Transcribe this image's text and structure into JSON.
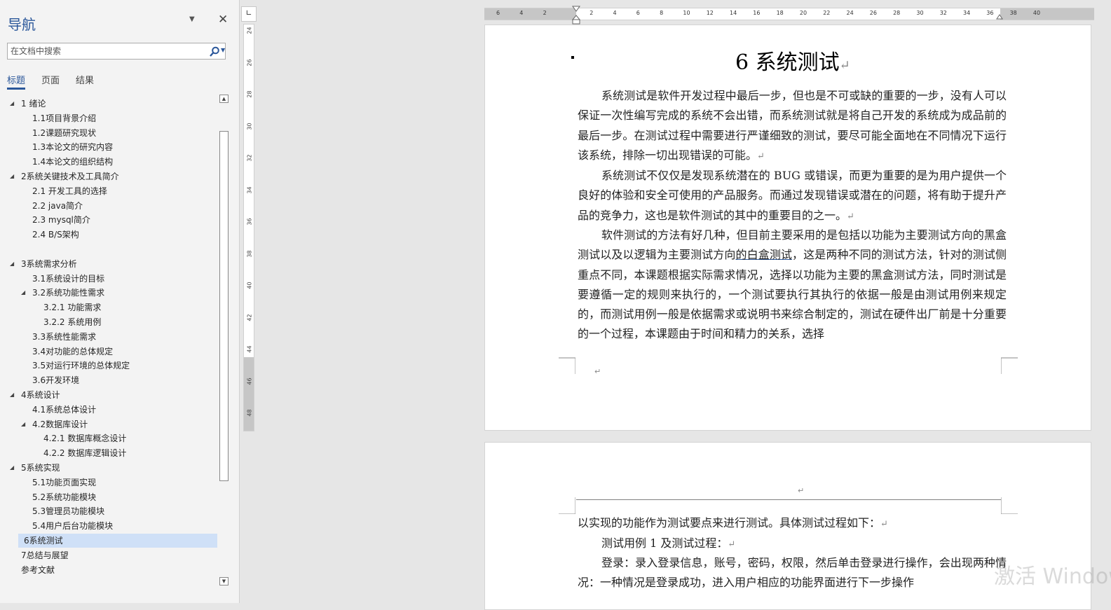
{
  "nav": {
    "title": "导航",
    "search_placeholder": "在文档中搜索",
    "tabs": [
      "标题",
      "页面",
      "结果"
    ],
    "tree": [
      {
        "label": "1 绪论",
        "level": 1,
        "expanded": true
      },
      {
        "label": "1.1项目背景介绍",
        "level": 2
      },
      {
        "label": "1.2课题研究现状",
        "level": 2
      },
      {
        "label": "1.3本论文的研究内容",
        "level": 2
      },
      {
        "label": "1.4本论文的组织结构",
        "level": 2
      },
      {
        "label": "2系统关键技术及工具简介",
        "level": 1,
        "expanded": true
      },
      {
        "label": "2.1 开发工具的选择",
        "level": 2
      },
      {
        "label": "2.2 java简介",
        "level": 2
      },
      {
        "label": "2.3 mysql简介",
        "level": 2
      },
      {
        "label": "2.4 B/S架构",
        "level": 2
      },
      {
        "label": "",
        "level": 2
      },
      {
        "label": "3系统需求分析",
        "level": 1,
        "expanded": true
      },
      {
        "label": "3.1系统设计的目标",
        "level": 2
      },
      {
        "label": "3.2系统功能性需求",
        "level": 2,
        "expanded": true
      },
      {
        "label": "3.2.1 功能需求",
        "level": 3
      },
      {
        "label": "3.2.2 系统用例",
        "level": 3
      },
      {
        "label": "3.3系统性能需求",
        "level": 2
      },
      {
        "label": "3.4对功能的总体规定",
        "level": 2
      },
      {
        "label": "3.5对运行环境的总体规定",
        "level": 2
      },
      {
        "label": "3.6开发环境",
        "level": 2
      },
      {
        "label": "4系统设计",
        "level": 1,
        "expanded": true
      },
      {
        "label": "4.1系统总体设计",
        "level": 2
      },
      {
        "label": "4.2数据库设计",
        "level": 2,
        "expanded": true
      },
      {
        "label": "4.2.1 数据库概念设计",
        "level": 3
      },
      {
        "label": "4.2.2 数据库逻辑设计",
        "level": 3
      },
      {
        "label": "5系统实现",
        "level": 1,
        "expanded": true
      },
      {
        "label": "5.1功能页面实现",
        "level": 2
      },
      {
        "label": "5.2系统功能模块",
        "level": 2
      },
      {
        "label": "5.3管理员功能模块",
        "level": 2
      },
      {
        "label": "5.4用户后台功能模块",
        "level": 2
      },
      {
        "label": "6系统测试",
        "level": 1,
        "selected": true
      },
      {
        "label": "7总结与展望",
        "level": 1
      },
      {
        "label": "参考文献",
        "level": 1
      }
    ]
  },
  "vruler": {
    "numbers": [
      "24",
      "26",
      "28",
      "30",
      "32",
      "34",
      "36",
      "38",
      "40",
      "42",
      "44",
      "46",
      "48"
    ]
  },
  "hruler": {
    "numbers": [
      "6",
      "4",
      "2",
      "",
      "2",
      "4",
      "6",
      "8",
      "10",
      "12",
      "14",
      "16",
      "18",
      "20",
      "22",
      "24",
      "26",
      "28",
      "30",
      "32",
      "34",
      "36",
      "38",
      "40"
    ]
  },
  "document": {
    "title": "6 系统测试",
    "para_mark": "↵",
    "page1_paragraphs": [
      "系统测试是软件开发过程中最后一步，但也是不可或缺的重要的一步，没有人可以保证一次性编写完成的系统不会出错，而系统测试就是将自己开发的系统成为成品前的最后一步。在测试过程中需要进行严谨细致的测试，要尽可能全面地在不同情况下运行该系统，排除一切出现错误的可能。",
      "系统测试不仅仅是发现系统潜在的 BUG 或错误，而更为重要的是为用户提供一个良好的体验和安全可使用的产品服务。而通过发现错误或潜在的问题，将有助于提升产品的竞争力，这也是软件测试的其中的重要目的之一。"
    ],
    "page1_para3_before": "软件测试的方法有好几种，但目前主要采用的是包括以功能为主要测试方向的黑盒测试以及以逻辑为主要测试方向",
    "page1_para3_link": "的白盒测试",
    "page1_para3_after": "，这是两种不同的测试方法，针对的测试侧重点不同，本课题根据实际需求情况，选择以功能为主要的黑盒测试方法，同时测试是要遵循一定的规则来执行的，一个测试要执行其执行的依据一般是由测试用例来规定的，而测试用例一般是依据需求或说明书来综合制定的，测试在硬件出厂前是十分重要的一个过程，本课题由于时间和精力的关系，选择",
    "page2_lines": [
      "以实现的功能作为测试要点来进行测试。具体测试过程如下：",
      "测试用例 1 及测试过程：",
      "登录：录入登录信息，账号，密码，权限，然后单击登录进行操作，会出现两种情况：一种情况是登录成功，进入用户相应的功能界面进行下一步操作"
    ]
  },
  "watermark": "激活 Windows"
}
